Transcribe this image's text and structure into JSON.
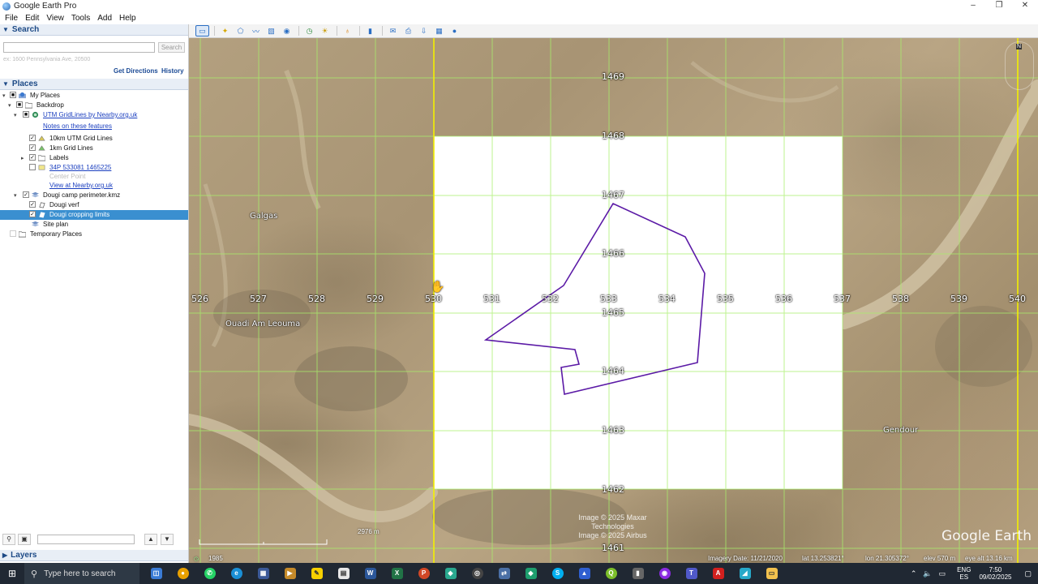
{
  "window": {
    "title": "Google Earth Pro",
    "controls": {
      "minimize": "–",
      "restore": "❐",
      "close": "✕"
    }
  },
  "menu": [
    "File",
    "Edit",
    "View",
    "Tools",
    "Add",
    "Help"
  ],
  "search": {
    "header": "Search",
    "placeholder": "",
    "button": "Search",
    "hint": "ex: 1600 Pennsylvania Ave, 20500",
    "get_directions": "Get Directions",
    "history": "History"
  },
  "places": {
    "header": "Places",
    "items": [
      {
        "label": "My Places",
        "level": 0,
        "expanded": true,
        "checkbox": "partial",
        "icon": "globe-folder-icon"
      },
      {
        "label": "Backdrop",
        "level": 1,
        "expanded": true,
        "checkbox": "partial",
        "icon": "folder-icon"
      },
      {
        "label": "UTM GridLines by Nearby.org.uk",
        "level": 2,
        "expanded": true,
        "checkbox": "partial",
        "icon": "network-link-icon",
        "link": true
      },
      {
        "label": "Notes on these features",
        "level": 3,
        "link": true
      },
      {
        "label": "10km UTM Grid Lines",
        "level": 3,
        "checkbox": "checked",
        "icon": "grid-layer-icon"
      },
      {
        "label": "1km Grid Lines",
        "level": 3,
        "checkbox": "checked",
        "icon": "grid-layer-icon"
      },
      {
        "label": "Labels",
        "level": 3,
        "expandable": true,
        "checkbox": "checked",
        "icon": "folder-icon"
      },
      {
        "label": "34P 533081 1465225",
        "level": 3,
        "checkbox": "unchecked",
        "icon": "placemark-icon",
        "link": true
      },
      {
        "label": "Center Point",
        "level": 4,
        "dim": true
      },
      {
        "label": "View at Nearby.org.uk",
        "level": 4,
        "link": true
      },
      {
        "label": "Dougi camp perimeter.kmz",
        "level": 1,
        "expanded": true,
        "checkbox": "checked",
        "icon": "kmz-icon"
      },
      {
        "label": "Dougi verf",
        "level": 2,
        "checkbox": "checked",
        "icon": "polygon-icon"
      },
      {
        "label": "Dougi cropping limits",
        "level": 2,
        "checkbox": "checked",
        "icon": "polygon-icon",
        "selected": true
      },
      {
        "label": "Site plan",
        "level": 2,
        "icon": "image-overlay-icon"
      },
      {
        "label": "Temporary Places",
        "level": 0,
        "icon": "folder-icon"
      }
    ]
  },
  "layers": {
    "header": "Layers"
  },
  "map": {
    "place_labels": [
      "Galgas",
      "Ouadi Am Leouma",
      "Gendour"
    ],
    "easting_labels": [
      "526",
      "527",
      "528",
      "529",
      "530",
      "531",
      "532",
      "533",
      "534",
      "535",
      "536",
      "537",
      "538",
      "539",
      "540"
    ],
    "northing_labels": [
      "1469",
      "1468",
      "1467",
      "1466",
      "1465",
      "1464",
      "1463",
      "1462",
      "1461"
    ],
    "attribution": "Image © 2025 Maxar Technologies\nImage © 2025 Airbus",
    "logo": "Google Earth",
    "scale": "2976 m",
    "historical_year": "1985",
    "status": {
      "imagery_date": "Imagery Date: 11/21/2020",
      "lat": "lat  13.253821°",
      "lon": "lon  21.305372°",
      "elev": "elev  570 m",
      "eye_alt": "eye alt  13.16 km"
    },
    "nav_north": "N",
    "colors": {
      "grid_line": "#a8f06a",
      "zone_line": "#f3f000",
      "polygon": "#5b1aa6",
      "overlay": "#ffffff"
    }
  },
  "taskbar": {
    "search_placeholder": "Type here to search",
    "language": "ENG",
    "region": "ES",
    "time": "7:50",
    "date": "09/02/2025"
  }
}
